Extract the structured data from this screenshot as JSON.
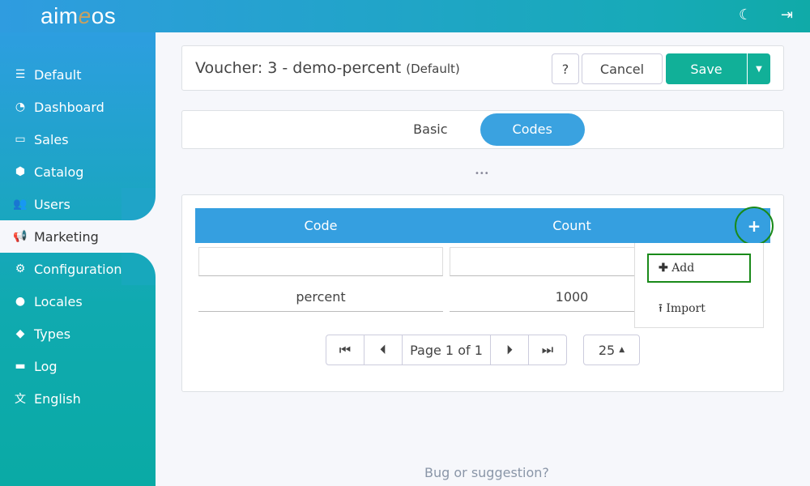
{
  "app": {
    "logo": "aimeos"
  },
  "sidebar": {
    "items": [
      {
        "label": "Default",
        "icon": "server-icon"
      },
      {
        "label": "Dashboard",
        "icon": "gauge-icon"
      },
      {
        "label": "Sales",
        "icon": "money-icon"
      },
      {
        "label": "Catalog",
        "icon": "cubes-icon"
      },
      {
        "label": "Users",
        "icon": "users-icon"
      },
      {
        "label": "Marketing",
        "icon": "bullhorn-icon"
      },
      {
        "label": "Configuration",
        "icon": "gears-icon"
      },
      {
        "label": "Locales",
        "icon": "globe-icon"
      },
      {
        "label": "Types",
        "icon": "tag-icon"
      },
      {
        "label": "Log",
        "icon": "archive-icon"
      },
      {
        "label": "English",
        "icon": "language-icon"
      }
    ]
  },
  "header": {
    "title": "Voucher: 3 - demo-percent",
    "site": "(Default)",
    "help": "?",
    "cancel": "Cancel",
    "save": "Save"
  },
  "tabs": [
    "Basic",
    "Codes"
  ],
  "more": "•••",
  "table": {
    "columns": [
      "Code",
      "Count"
    ],
    "rows": [
      {
        "code": "percent",
        "count": "1000"
      }
    ]
  },
  "menu": {
    "add": "Add",
    "import": "Import"
  },
  "pagination": {
    "page": "Page 1 of 1",
    "size": "25"
  },
  "footer": {
    "link": "Bug or suggestion?"
  }
}
